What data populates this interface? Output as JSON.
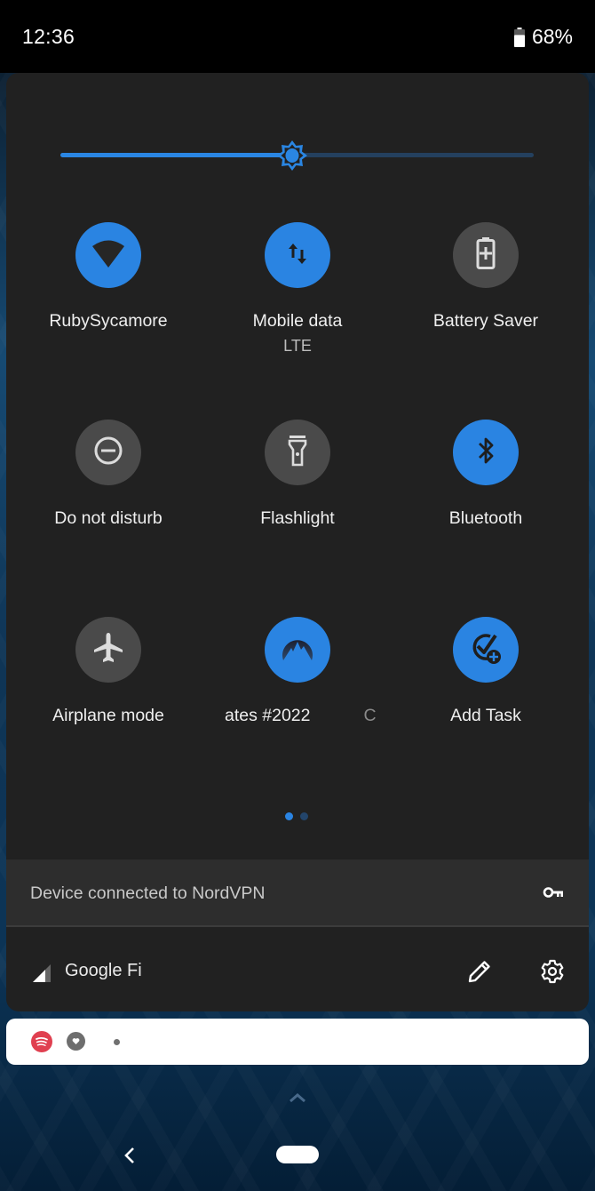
{
  "status_bar": {
    "time": "12:36",
    "battery_percent_label": "68%",
    "battery_level": 0.68,
    "battery_icon": "battery-icon"
  },
  "brightness": {
    "value": 0.49,
    "icon": "brightness-icon",
    "accent": "#2a86e3"
  },
  "tiles": [
    {
      "label": "RubySycamore",
      "sublabel": "",
      "icon": "wifi-icon",
      "state": "on"
    },
    {
      "label": "Mobile data",
      "sublabel": "LTE",
      "icon": "mobile-data-icon",
      "state": "on"
    },
    {
      "label": "Battery Saver",
      "sublabel": "",
      "icon": "battery-saver-icon",
      "state": "off"
    },
    {
      "label": "Do not disturb",
      "sublabel": "",
      "icon": "do-not-disturb-icon",
      "state": "off"
    },
    {
      "label": "Flashlight",
      "sublabel": "",
      "icon": "flashlight-icon",
      "state": "off"
    },
    {
      "label": "Bluetooth",
      "sublabel": "",
      "icon": "bluetooth-icon",
      "state": "on"
    },
    {
      "label": "Airplane mode",
      "sublabel": "",
      "icon": "airplane-icon",
      "state": "off"
    },
    {
      "label": "ates #2022",
      "label_trailing": "C",
      "sublabel": "",
      "icon": "nordvpn-icon",
      "state": "on"
    },
    {
      "label": "Add Task",
      "sublabel": "",
      "icon": "add-task-icon",
      "state": "on"
    }
  ],
  "pagination": {
    "pages": 2,
    "current": 1
  },
  "vpn": {
    "text": "Device connected to NordVPN",
    "icon": "key-icon"
  },
  "footer": {
    "carrier": "Google Fi",
    "signal_icon": "signal-icon",
    "edit_icon": "pencil-icon",
    "settings_icon": "gear-icon"
  },
  "notification": {
    "icons": [
      "spotify-icon",
      "heart-icon",
      "more-dot-icon"
    ]
  },
  "colors": {
    "tile_on": "#2a84e2",
    "tile_off": "#4a4a4a",
    "panel_bg": "#212121"
  }
}
